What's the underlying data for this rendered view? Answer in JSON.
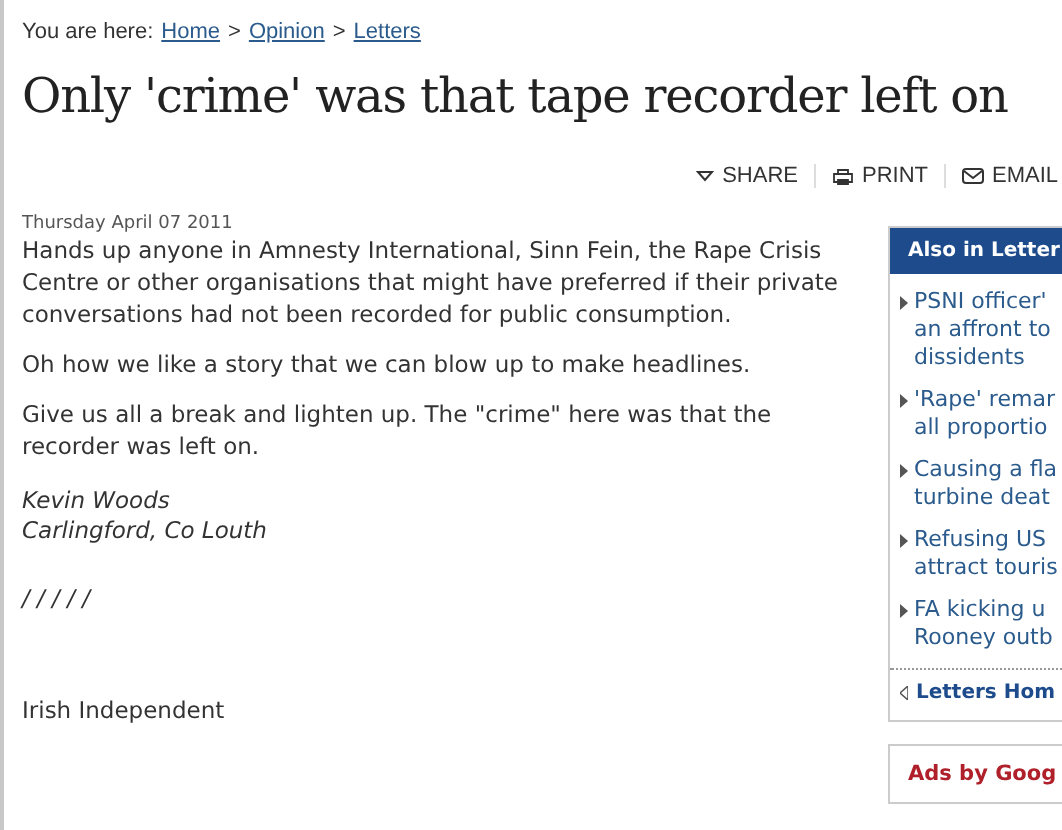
{
  "breadcrumb": {
    "label": "You are here:",
    "links": [
      "Home",
      "Opinion",
      "Letters"
    ],
    "separator": ">"
  },
  "title": "Only 'crime' was that tape recorder left on",
  "actions": [
    {
      "kind": "share",
      "label": "SHARE"
    },
    {
      "kind": "print",
      "label": "PRINT"
    },
    {
      "kind": "email",
      "label": "EMAIL"
    }
  ],
  "article": {
    "date": "Thursday April 07 2011",
    "paragraphs": [
      "Hands up anyone in Amnesty International, Sinn Fein, the Rape Crisis Centre or other organisations that might have preferred if their private conversations had not been recorded for public consumption.",
      "Oh how we like a story that we can blow up to make headlines.",
      "Give us all a break and lighten up. The \"crime\" here was that the recorder was left on."
    ],
    "author": [
      "Kevin Woods",
      "Carlingford, Co Louth"
    ],
    "marks": "/ / / / /",
    "source": "Irish Independent"
  },
  "sidebar": {
    "title": "Also in Letter",
    "items": [
      [
        "PSNI officer'",
        "an affront to",
        "dissidents"
      ],
      [
        "'Rape' remar",
        "all proportio"
      ],
      [
        "Causing a fla",
        "turbine deat"
      ],
      [
        "Refusing US",
        "attract touris"
      ],
      [
        "FA kicking u",
        "Rooney outb"
      ]
    ],
    "footer": "Letters Hom"
  },
  "ads": {
    "title": "Ads by Goog"
  }
}
